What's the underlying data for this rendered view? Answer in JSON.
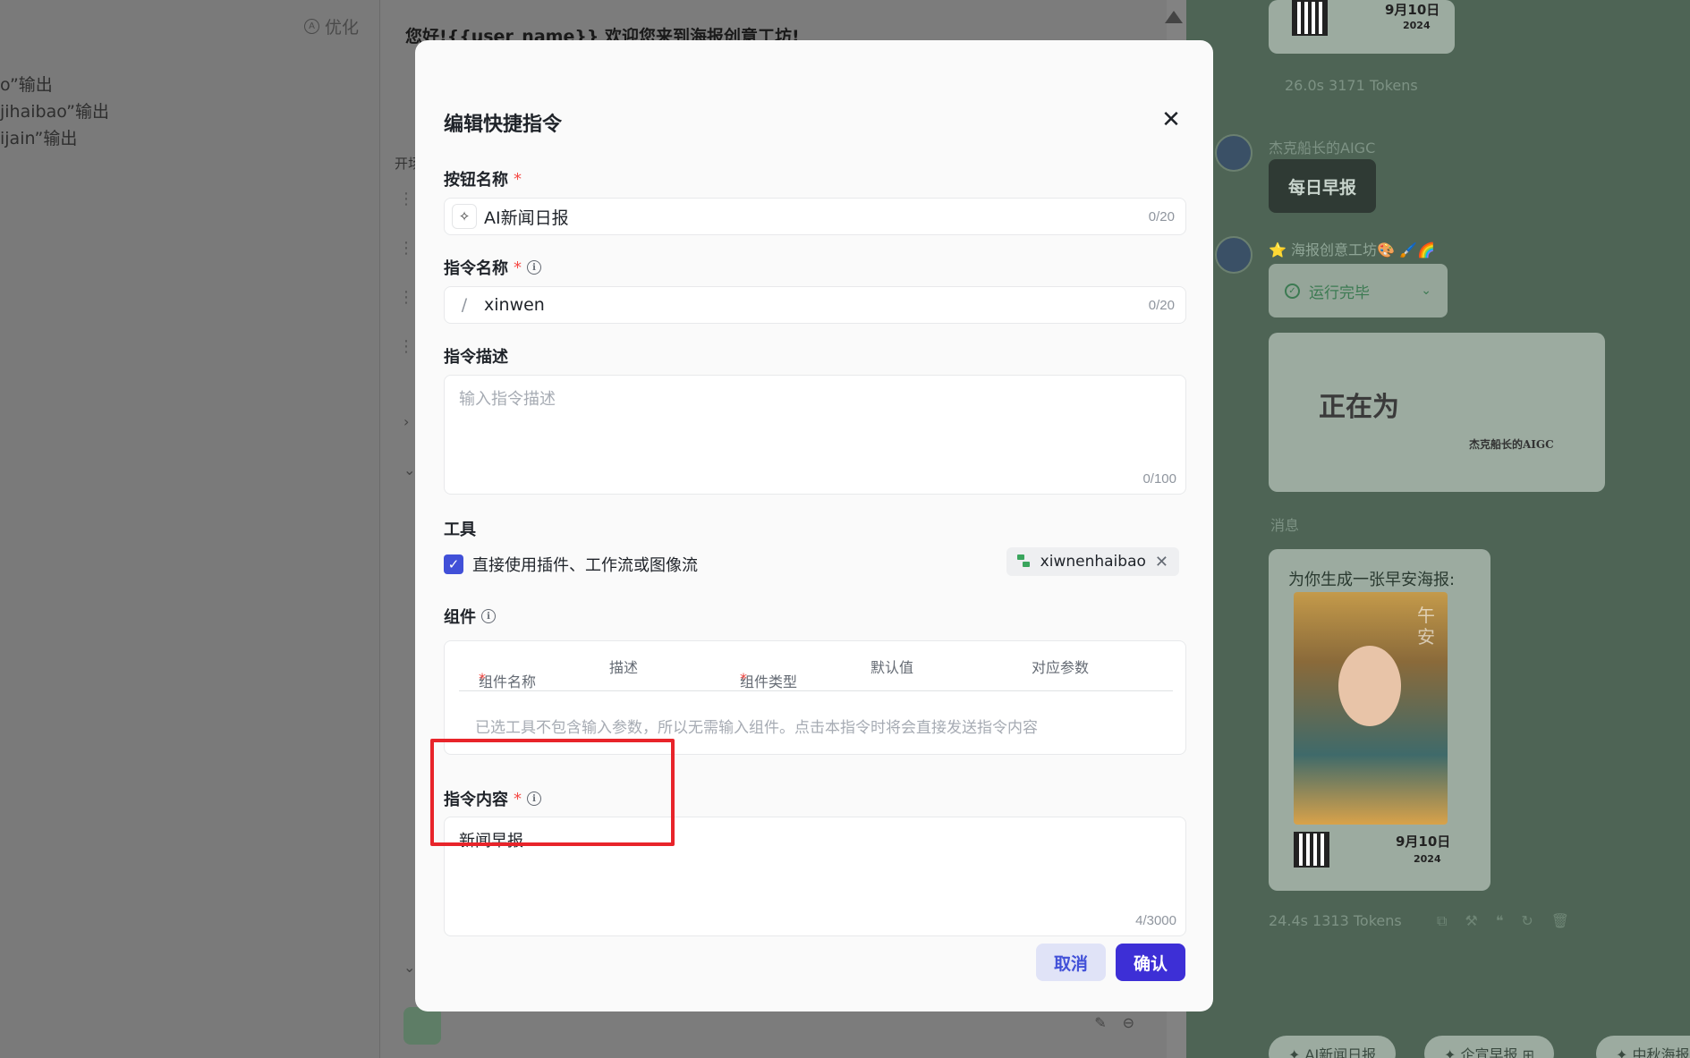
{
  "background": {
    "left": {
      "optimize_label": "优化",
      "lines": [
        "o”输出",
        "jihaibao”输出",
        "ijain”输出"
      ]
    },
    "middle": {
      "welcome_text": "您好!{{user_name}} 欢迎您来到海报创意工坊!",
      "start_label": "开场"
    },
    "right": {
      "top_stats": "26.0s  3171 Tokens",
      "date_big": "9月10日",
      "date_year": "2024",
      "user_name": "杰克船长的AIGC",
      "daily_button": "每日早报",
      "bot_name": "⭐ 海报创意工坊🎨 🖌️🌈",
      "status": "运行完毕",
      "preview_big": "正在为",
      "preview_small": "杰克船长的AIGC",
      "message_label": "消息",
      "reply_text": "为你生成一张早安海报:",
      "poster_chars": "午安",
      "poster_date": "9月10日",
      "poster_year": "2024",
      "bottom_stats": "24.4s  1313 Tokens",
      "pills": [
        "✦ AI新闻日报",
        "✦ 企宣早报 ⊞",
        "✦ 中秋海报"
      ]
    }
  },
  "modal": {
    "title": "编辑快捷指令",
    "button_name": {
      "label": "按钮名称",
      "value": "AI新闻日报",
      "counter": "0/20"
    },
    "command_name": {
      "label": "指令名称",
      "prefix": "/",
      "value": "xinwen",
      "counter": "0/20"
    },
    "description": {
      "label": "指令描述",
      "placeholder": "输入指令描述",
      "counter": "0/100"
    },
    "tools": {
      "label": "工具",
      "checkbox_label": "直接使用插件、工作流或图像流",
      "tag": "xiwnenhaibao"
    },
    "components": {
      "label": "组件",
      "columns": [
        "组件名称",
        "描述",
        "组件类型",
        "默认值",
        "对应参数"
      ],
      "empty_text": "已选工具不包含输入参数，所以无需输入组件。点击本指令时将会直接发送指令内容"
    },
    "content": {
      "label": "指令内容",
      "value": "新闻早报",
      "counter": "4/3000"
    },
    "cancel_label": "取消",
    "confirm_label": "确认"
  },
  "colors": {
    "accent": "#3d2fd6",
    "required": "#f54a45",
    "highlight": "#e8242a"
  }
}
